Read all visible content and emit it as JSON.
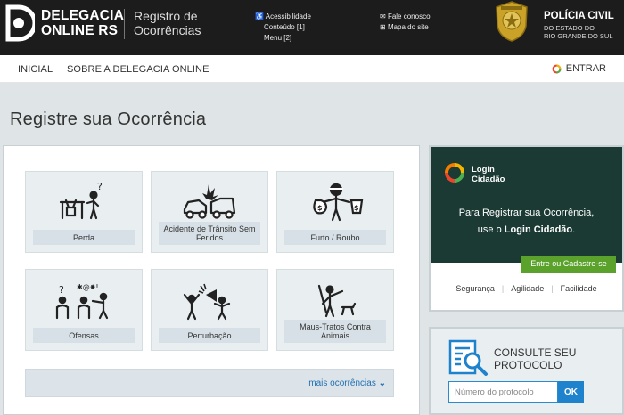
{
  "header": {
    "brand_line1": "DELEGACIA",
    "brand_line2": "ONLINE RS",
    "sub_line1": "Registro de",
    "sub_line2": "Ocorrências",
    "accessibility": "Acessibilidade",
    "content_link": "Conteúdo [1]",
    "menu_link": "Menu [2]",
    "contact": "Fale conosco",
    "sitemap": "Mapa do site",
    "org_title": "POLÍCIA CIVIL",
    "org_sub1": "DO ESTADO DO",
    "org_sub2": "RIO GRANDE DO SUL"
  },
  "nav": {
    "home": "INICIAL",
    "about": "SOBRE A DELEGACIA ONLINE",
    "login": "ENTRAR"
  },
  "page_title": "Registre sua Ocorrência",
  "tiles": [
    {
      "label": "Perda",
      "icon": "person-desk-question-icon"
    },
    {
      "label": "Acidente de Trânsito Sem Feridos",
      "icon": "car-crash-icon"
    },
    {
      "label": "Furto / Roubo",
      "icon": "thief-money-bags-icon"
    },
    {
      "label": "Ofensas",
      "icon": "people-arguing-icon"
    },
    {
      "label": "Perturbação",
      "icon": "megaphone-noise-icon"
    },
    {
      "label": "Maus-Tratos Contra Animais",
      "icon": "animal-abuse-icon"
    }
  ],
  "more_occurrences": "mais ocorrências",
  "login_card": {
    "brand1": "Login",
    "brand2": "Cidadão",
    "text1": "Para Registrar sua Ocorrência,",
    "text2_prefix": "use o ",
    "text2_bold": "Login Cidadão",
    "text2_suffix": ".",
    "button": "Entre ou Cadastre-se",
    "features": [
      "Segurança",
      "Agilidade",
      "Facilidade"
    ]
  },
  "protocol": {
    "title1": "CONSULTE SEU",
    "title2": "PROTOCOLO",
    "placeholder": "Número do protocolo",
    "button": "OK"
  },
  "colors": {
    "header_bg": "#1c1c1c",
    "login_bg": "#1a3a33",
    "green": "#5aa22c",
    "blue": "#1e82cc",
    "link": "#1f6fb2"
  }
}
